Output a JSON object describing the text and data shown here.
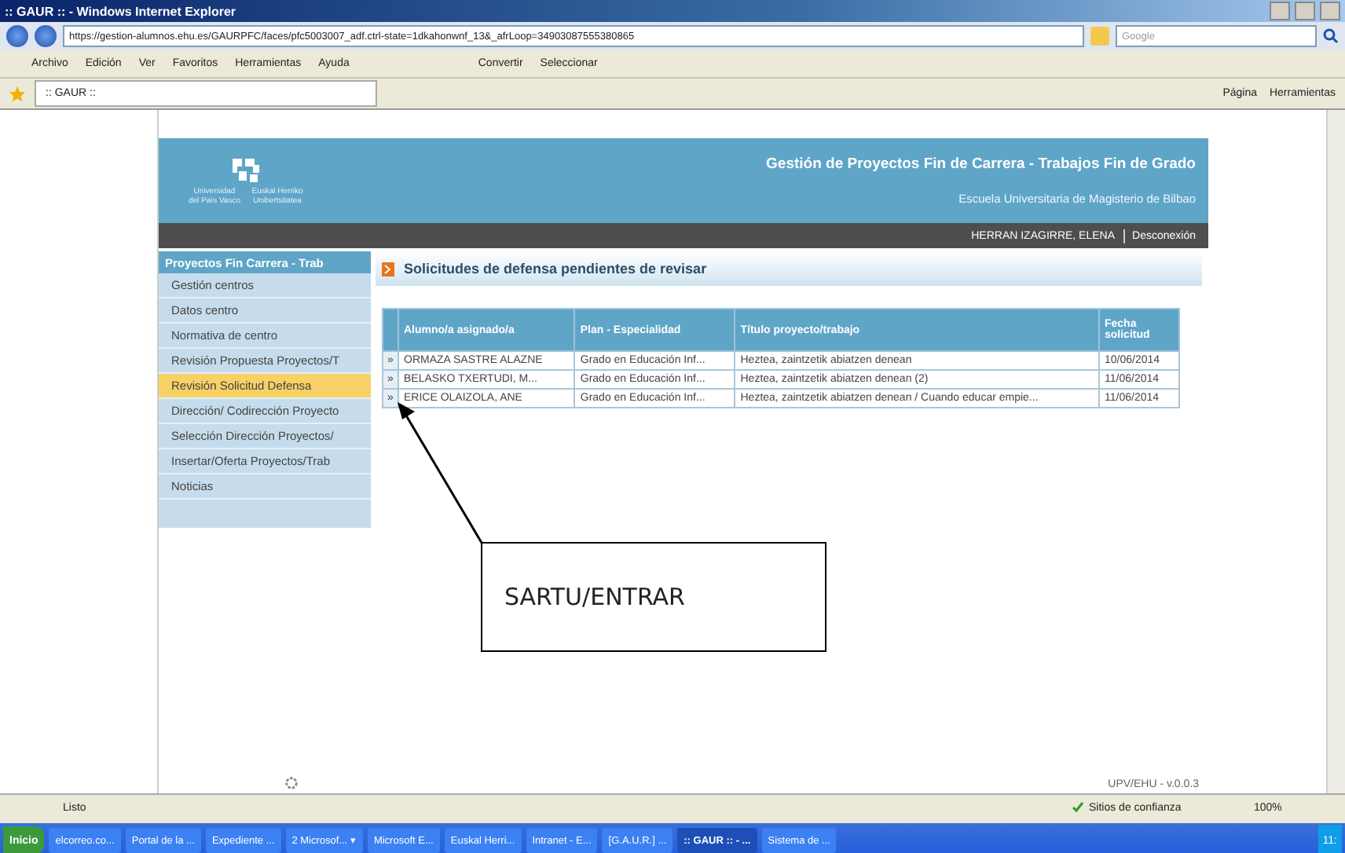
{
  "window": {
    "title": ":: GAUR :: - Windows Internet Explorer"
  },
  "address_bar": {
    "url": "https://gestion-alumnos.ehu.es/GAURPFC/faces/pfc5003007_adf.ctrl-state=1dkahonwnf_13&_afrLoop=34903087555380865"
  },
  "search": {
    "placeholder": "Google"
  },
  "menu": [
    "Archivo",
    "Edición",
    "Ver",
    "Favoritos",
    "Herramientas",
    "Ayuda"
  ],
  "toolbar": [
    "Convertir",
    "Seleccionar"
  ],
  "tab": {
    "label": ":: GAUR ::"
  },
  "command_bar": [
    "Página",
    "Herramientas"
  ],
  "site_header": {
    "logo_left": "Universidad del País Vasco",
    "logo_right": "Euskal Herriko Unibertsitatea",
    "title": "Gestión de Proyectos Fin de Carrera - Trabajos Fin de Grado",
    "subtitle": "Escuela Universitaria de Magisterio de Bilbao",
    "user": "HERRAN IZAGIRRE, ELENA",
    "logout": "Desconexión"
  },
  "sidebar": {
    "title": "Proyectos Fin Carrera - Trab",
    "items": [
      {
        "label": "Gestión centros",
        "selected": false
      },
      {
        "label": "Datos centro",
        "selected": false
      },
      {
        "label": "Normativa de centro",
        "selected": false
      },
      {
        "label": "Revisión Propuesta Proyectos/T",
        "selected": false
      },
      {
        "label": "Revisión Solicitud Defensa",
        "selected": true
      },
      {
        "label": "Dirección/ Codirección Proyecto",
        "selected": false
      },
      {
        "label": "Selección Dirección Proyectos/",
        "selected": false
      },
      {
        "label": "Insertar/Oferta Proyectos/Trab",
        "selected": false
      },
      {
        "label": "Noticias",
        "selected": false
      }
    ]
  },
  "content": {
    "heading": "Solicitudes de defensa pendientes de revisar",
    "table": {
      "columns": [
        "Alumno/a asignado/a",
        "Plan - Especialidad",
        "Título proyecto/trabajo",
        "Fecha solicitud"
      ],
      "rows": [
        {
          "open": "»",
          "cells": [
            "ORMAZA SASTRE ALAZNE",
            "Grado en Educación Inf...",
            "Heztea, zaintzetik abiatzen denean",
            "10/06/2014"
          ]
        },
        {
          "open": "»",
          "cells": [
            "BELASKO TXERTUDI, M...",
            "Grado en Educación Inf...",
            "Heztea, zaintzetik abiatzen denean (2)",
            "11/06/2014"
          ]
        },
        {
          "open": "»",
          "cells": [
            "ERICE OLAIZOLA, ANE",
            "Grado en Educación Inf...",
            "Heztea, zaintzetik abiatzen denean / Cuando educar empie...",
            "11/06/2014"
          ]
        }
      ]
    }
  },
  "footer": {
    "version": "UPV/EHU - v.0.0.3"
  },
  "status_bar": {
    "text": "Listo",
    "zone": "Sitios de confianza",
    "zoom": "100%"
  },
  "taskbar": {
    "start": "Inicio",
    "items": [
      {
        "label": "elcorreo.co...",
        "selected": false
      },
      {
        "label": "Portal de la ...",
        "selected": false
      },
      {
        "label": "Expediente ...",
        "selected": false
      },
      {
        "label": "2 Microsof... ▾",
        "selected": false
      },
      {
        "label": "Microsoft E...",
        "selected": false
      },
      {
        "label": "Euskal Herri...",
        "selected": false
      },
      {
        "label": "Intranet - E...",
        "selected": false
      },
      {
        "label": "[G.A.U.R.] ...",
        "selected": false
      },
      {
        "label": ":: GAUR :: - ...",
        "selected": true
      },
      {
        "label": "Sistema de ...",
        "selected": false
      }
    ],
    "clock": "11:"
  },
  "annotation": {
    "label": "SARTU/ENTRAR"
  }
}
